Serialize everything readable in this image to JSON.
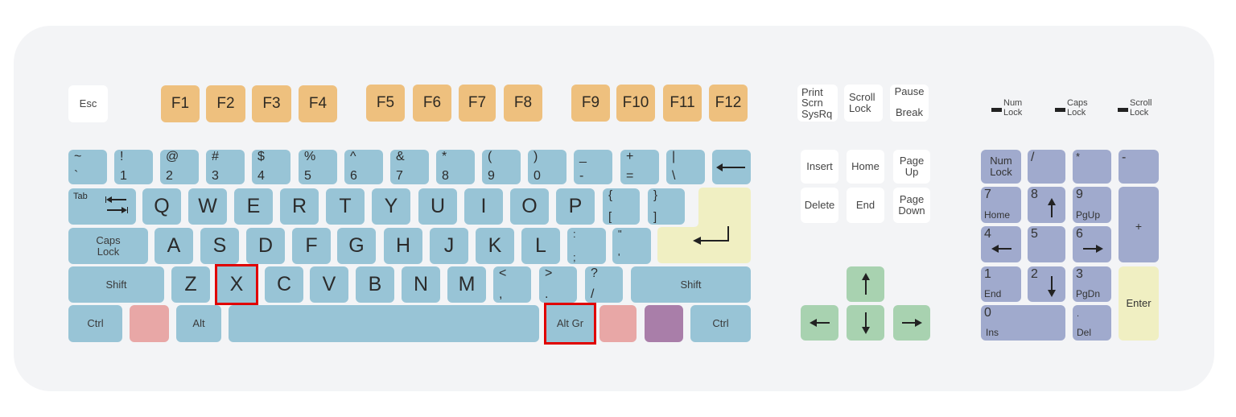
{
  "colors": {
    "board": "#f3f4f6",
    "main_keys": "#98c4d6",
    "function_keys": "#eec07e",
    "system_keys": "#ffffff",
    "enter_keys": "#f0efc2",
    "windows_keys": "#e8a7a6",
    "menu_key": "#a97ea9",
    "arrow_keys": "#a8d2b0",
    "numpad_keys": "#a0aacd",
    "highlight": "#e00000"
  },
  "highlighted_keys": [
    "X",
    "Alt Gr"
  ],
  "row_function": {
    "esc": "Esc",
    "fkeys": [
      "F1",
      "F2",
      "F3",
      "F4",
      "F5",
      "F6",
      "F7",
      "F8",
      "F9",
      "F10",
      "F11",
      "F12"
    ]
  },
  "system": {
    "print": [
      "Print",
      "Scrn",
      "SysRq"
    ],
    "scroll": [
      "Scroll",
      "Lock"
    ],
    "pause": [
      "Pause",
      "Break"
    ]
  },
  "indicators": [
    {
      "line1": "Num",
      "line2": "Lock"
    },
    {
      "line1": "Caps",
      "line2": "Lock"
    },
    {
      "line1": "Scroll",
      "line2": "Lock"
    }
  ],
  "row_number": [
    {
      "top": "~",
      "bot": "`"
    },
    {
      "top": "!",
      "bot": "1"
    },
    {
      "top": "@",
      "bot": "2"
    },
    {
      "top": "#",
      "bot": "3"
    },
    {
      "top": "$",
      "bot": "4"
    },
    {
      "top": "%",
      "bot": "5"
    },
    {
      "top": "^",
      "bot": "6"
    },
    {
      "top": "&",
      "bot": "7"
    },
    {
      "top": "*",
      "bot": "8"
    },
    {
      "top": "(",
      "bot": "9"
    },
    {
      "top": ")",
      "bot": "0"
    },
    {
      "top": "_",
      "bot": "-"
    },
    {
      "top": "+",
      "bot": "="
    },
    {
      "top": "|",
      "bot": "\\"
    }
  ],
  "row_qwerty": {
    "tab": "Tab",
    "letters": [
      "Q",
      "W",
      "E",
      "R",
      "T",
      "Y",
      "U",
      "I",
      "O",
      "P"
    ],
    "brackets": [
      {
        "top": "{",
        "bot": "["
      },
      {
        "top": "}",
        "bot": "]"
      }
    ]
  },
  "row_home": {
    "caps": [
      "Caps",
      "Lock"
    ],
    "letters": [
      "A",
      "S",
      "D",
      "F",
      "G",
      "H",
      "J",
      "K",
      "L"
    ],
    "punct": [
      {
        "top": ":",
        "bot": ";"
      },
      {
        "top": "\"",
        "bot": "'"
      }
    ]
  },
  "row_shift": {
    "shift_left": "Shift",
    "letters": [
      "Z",
      "X",
      "C",
      "V",
      "B",
      "N",
      "M"
    ],
    "punct": [
      {
        "top": "<",
        "bot": ","
      },
      {
        "top": ">",
        "bot": "."
      },
      {
        "top": "?",
        "bot": "/"
      }
    ],
    "shift_right": "Shift"
  },
  "row_bottom": {
    "ctrl_left": "Ctrl",
    "alt": "Alt",
    "altgr": "Alt Gr",
    "ctrl_right": "Ctrl"
  },
  "nav": {
    "insert": "Insert",
    "home": "Home",
    "pageup": [
      "Page",
      "Up"
    ],
    "delete": "Delete",
    "end": "End",
    "pagedown": [
      "Page",
      "Down"
    ]
  },
  "numpad": {
    "numlock": [
      "Num",
      "Lock"
    ],
    "divide": "/",
    "multiply": "*",
    "minus": "-",
    "plus": "+",
    "enter": "Enter",
    "n7": {
      "top": "7",
      "bot": "Home"
    },
    "n8": {
      "top": "8"
    },
    "n9": {
      "top": "9",
      "bot": "PgUp"
    },
    "n4": {
      "top": "4"
    },
    "n5": {
      "top": "5"
    },
    "n6": {
      "top": "6"
    },
    "n1": {
      "top": "1",
      "bot": "End"
    },
    "n2": {
      "top": "2"
    },
    "n3": {
      "top": "3",
      "bot": "PgDn"
    },
    "n0": {
      "top": "0",
      "bot": "Ins"
    },
    "ndot": {
      "top": ".",
      "bot": "Del"
    }
  }
}
